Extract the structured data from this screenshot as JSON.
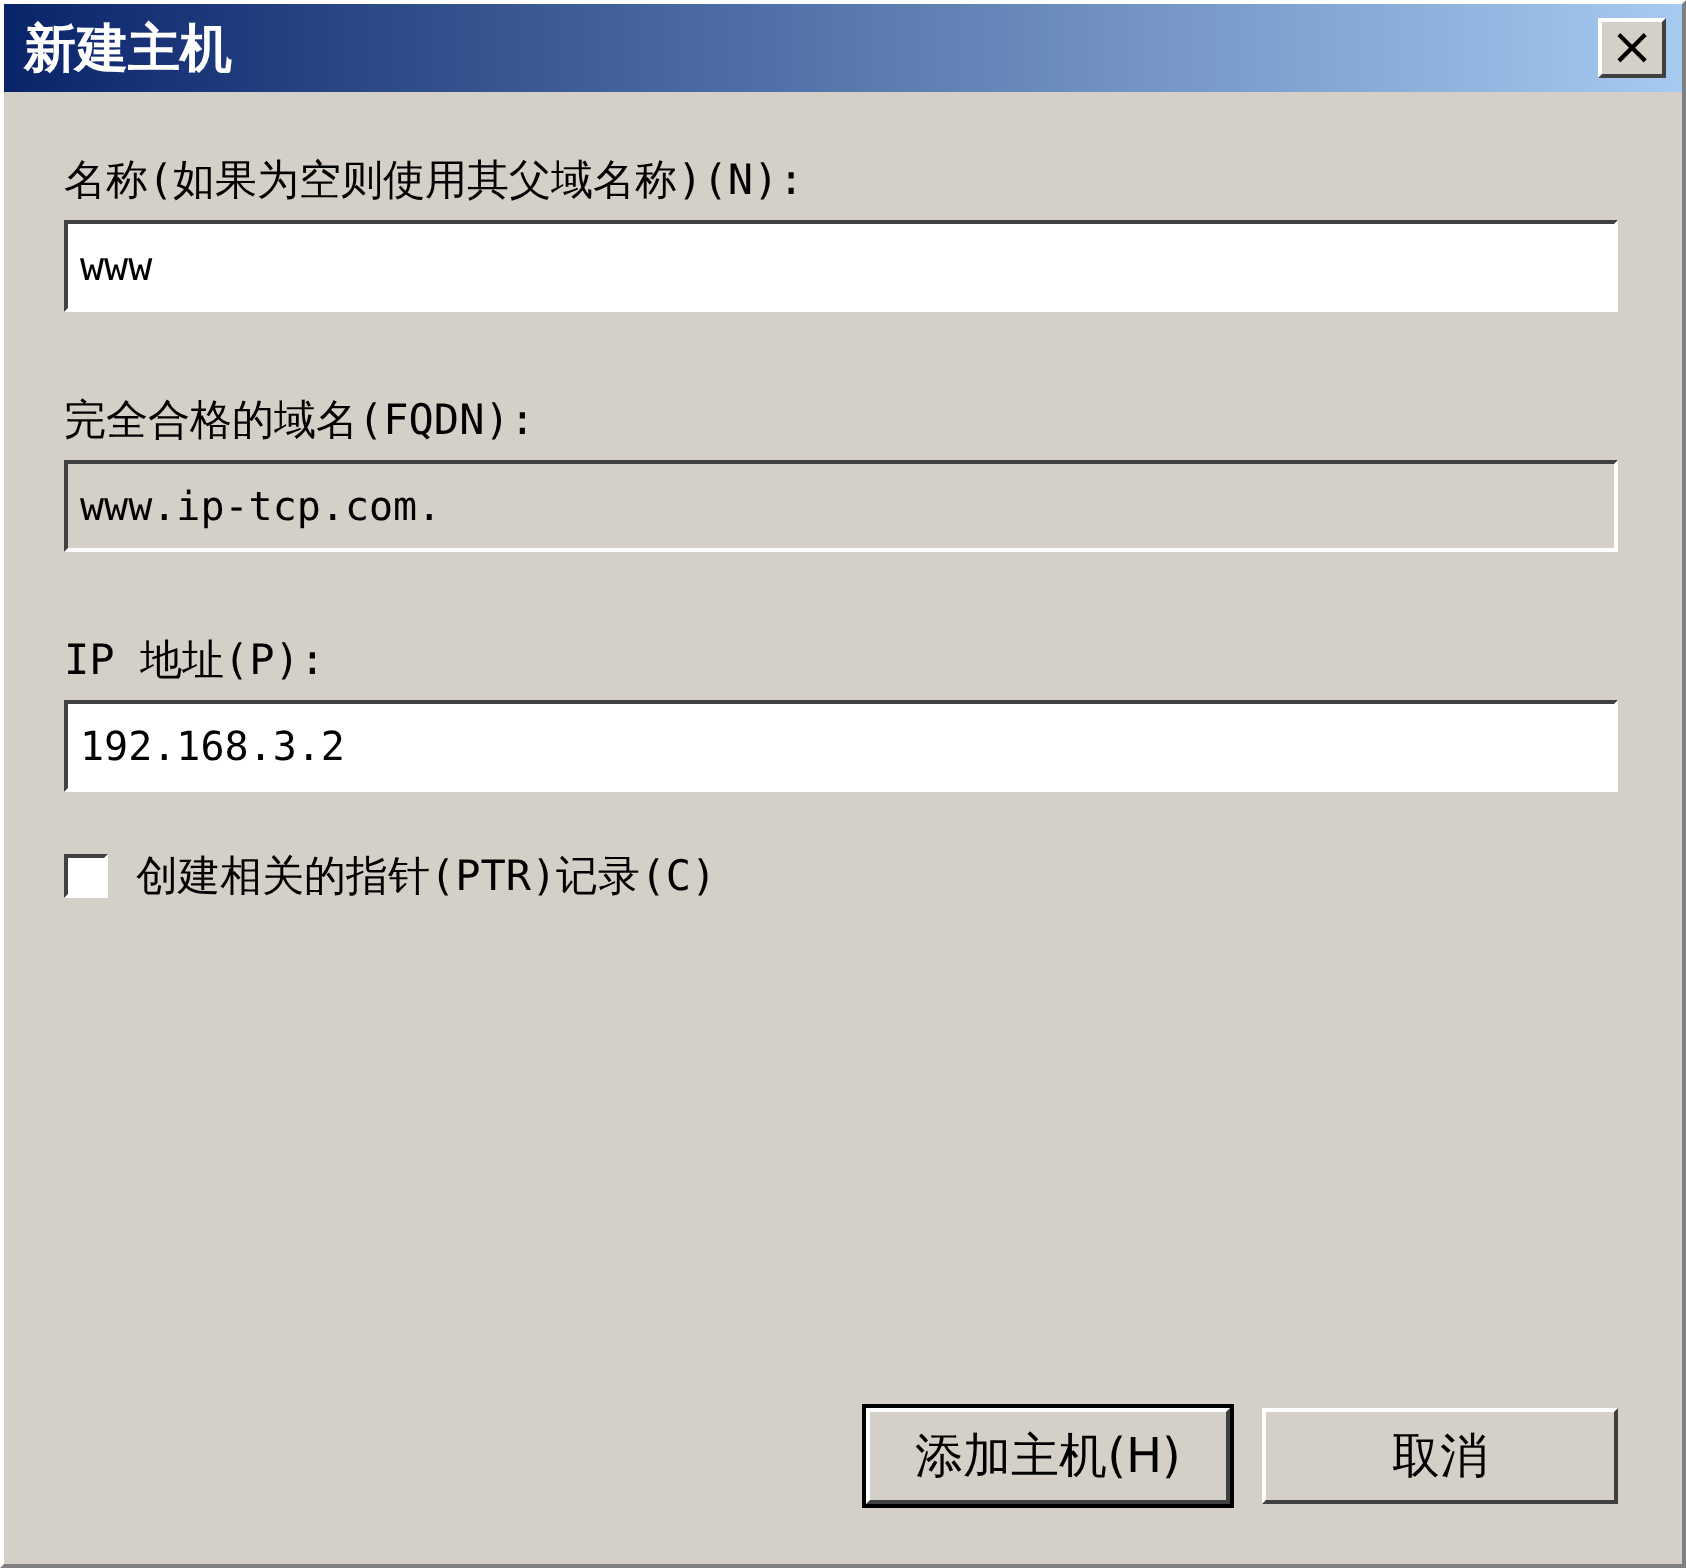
{
  "window": {
    "title": "新建主机",
    "close": "×"
  },
  "fields": [
    {
      "label": "名称(如果为空则使用其父域名称)(N):",
      "value": "www",
      "disabled": false
    },
    {
      "label": "完全合格的域名(FQDN):",
      "value": "www.ip-tcp.com.",
      "disabled": true
    },
    {
      "label": "IP 地址(P):",
      "value": "192.168.3.2",
      "disabled": false
    }
  ],
  "checkbox": {
    "label": "创建相关的指针(PTR)记录(C)",
    "checked": false
  },
  "buttons": [
    {
      "label": "添加主机(H)",
      "default": true
    },
    {
      "label": "取消",
      "default": false
    }
  ]
}
